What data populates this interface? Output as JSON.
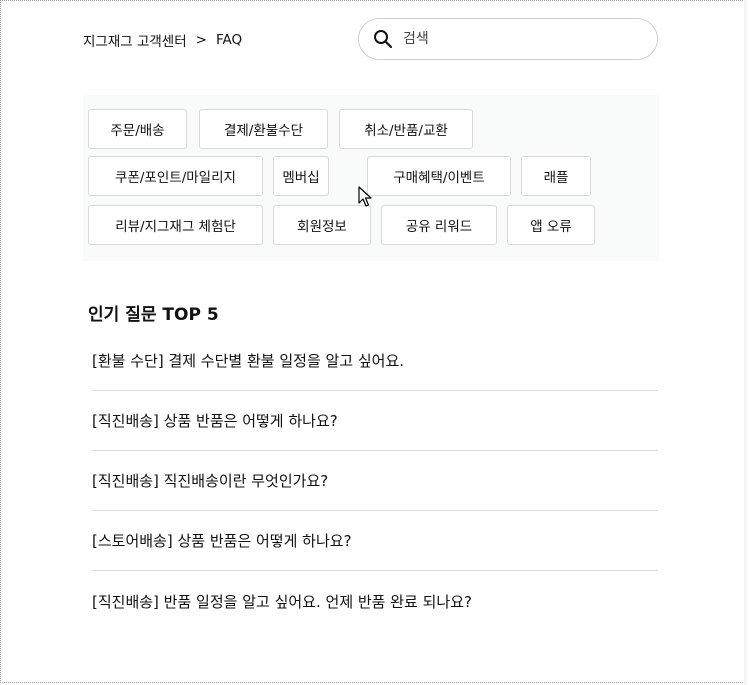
{
  "breadcrumb": {
    "home": "지그재그 고객센터",
    "separator": ">",
    "current": "FAQ"
  },
  "search": {
    "placeholder": "검색",
    "icon": "search-icon"
  },
  "categories": [
    "주문/배송",
    "결제/환불수단",
    "취소/반품/교환",
    "쿠폰/포인트/마일리지",
    "멤버십",
    "구매혜택/이벤트",
    "래플",
    "리뷰/지그재그 체험단",
    "회원정보",
    "공유 리워드",
    "앱 오류"
  ],
  "popular": {
    "title": "인기 질문 TOP 5",
    "items": [
      "[환불 수단] 결제 수단별 환불 일정을 알고 싶어요.",
      "[직진배송] 상품 반품은 어떻게 하나요?",
      "[직진배송] 직진배송이란 무엇인가요?",
      "[스토어배송] 상품 반품은 어떻게 하나요?",
      "[직진배송] 반품 일정을 알고 싶어요. 언제 반품 완료 되나요?"
    ]
  },
  "colors": {
    "panel_background": "#f9fafa",
    "chip_border": "#d9d9d9",
    "divider": "#dcdcdc",
    "text": "#111111"
  }
}
